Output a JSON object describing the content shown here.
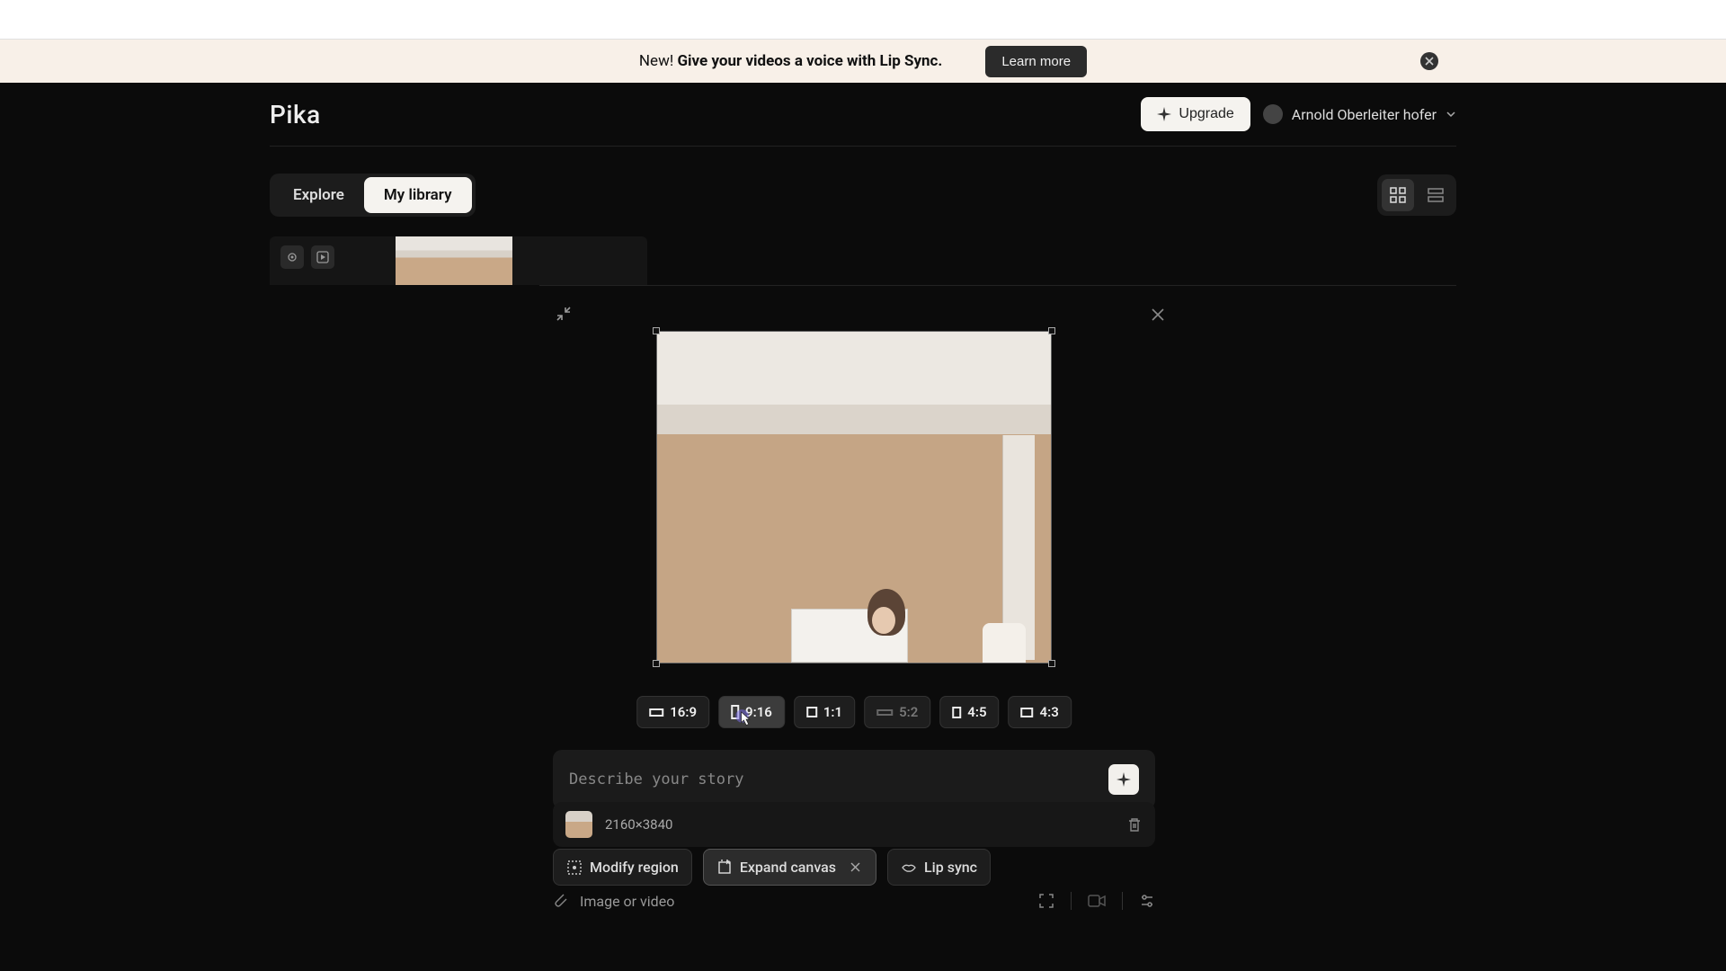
{
  "banner": {
    "prefix": "New! ",
    "bold": "Give your videos a voice with Lip Sync.",
    "button": "Learn more"
  },
  "header": {
    "logo": "Pika",
    "upgrade": "Upgrade",
    "user": "Arnold Oberleiter hofer"
  },
  "tabs": {
    "explore": "Explore",
    "library": "My library"
  },
  "ratios": {
    "r0": "16:9",
    "r1": "9:16",
    "r2": "1:1",
    "r3": "5:2",
    "r4": "4:5",
    "r5": "4:3"
  },
  "prompt": {
    "placeholder": "Describe your story"
  },
  "attachment": {
    "dimensions": "2160×3840"
  },
  "tools": {
    "modify": "Modify region",
    "expand": "Expand canvas",
    "lip": "Lip sync"
  },
  "bottom": {
    "label": "Image or video"
  }
}
